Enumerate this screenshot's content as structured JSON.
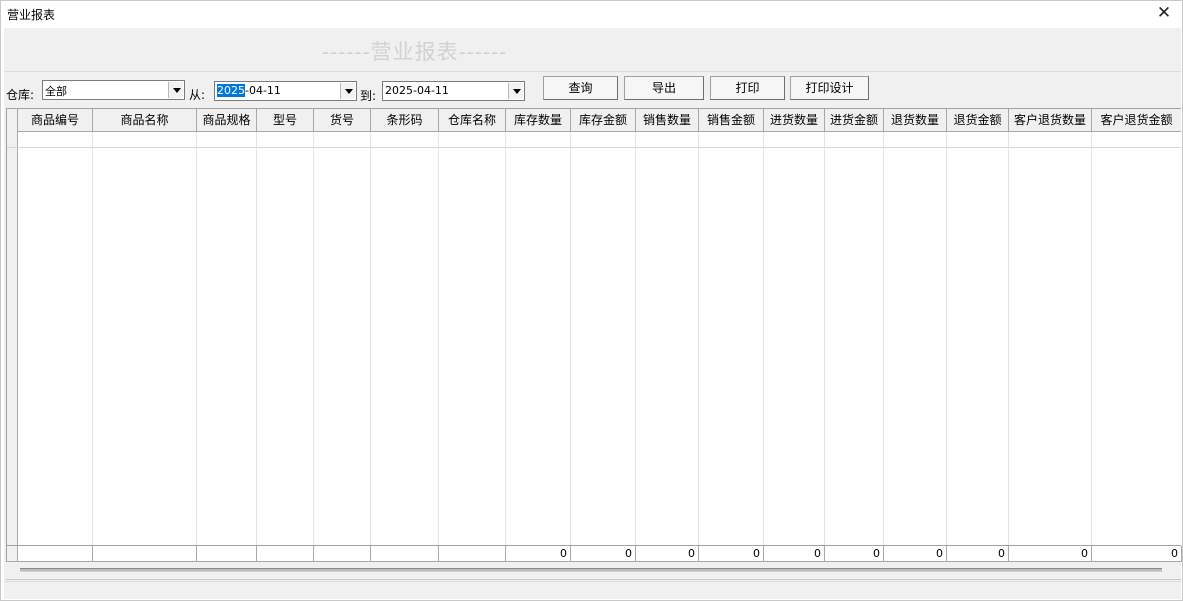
{
  "window": {
    "title": "营业报表",
    "close_glyph": "✕"
  },
  "banner": {
    "heading": "------营业报表------"
  },
  "toolbar": {
    "warehouse_label": "仓库:",
    "warehouse_value": "全部",
    "from_label": "从:",
    "from_date_selected": "2025",
    "from_date_rest": "-04-11",
    "to_label": "到:",
    "to_date": "2025-04-11",
    "buttons": {
      "query": "查询",
      "export": "导出",
      "print": "打印",
      "print_design": "打印设计"
    }
  },
  "grid": {
    "columns": [
      "商品编号",
      "商品名称",
      "商品规格",
      "型号",
      "货号",
      "条形码",
      "仓库名称",
      "库存数量",
      "库存金额",
      "销售数量",
      "销售金额",
      "进货数量",
      "进货金额",
      "退货数量",
      "退货金额",
      "客户退货数量",
      "客户退货金额"
    ],
    "totals": [
      "",
      "",
      "",
      "",
      "",
      "",
      "",
      "0",
      "0",
      "0",
      "0",
      "0",
      "0",
      "0",
      "0",
      "0",
      "0"
    ]
  },
  "colors": {
    "selection": "#0078d7",
    "header_bg": "#f0f0f0",
    "heading_text": "#d2d2d2"
  }
}
